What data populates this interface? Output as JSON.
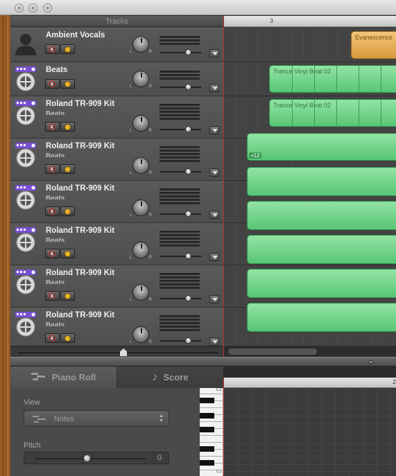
{
  "tracks_header": "Tracks",
  "tracks": [
    {
      "name": "Ambient Vocals",
      "subname": ""
    },
    {
      "name": "Beats",
      "subname": ""
    },
    {
      "name": "Roland TR-909 Kit",
      "subname": "Beats"
    },
    {
      "name": "Roland TR-909 Kit",
      "subname": "Beats"
    },
    {
      "name": "Roland TR-909 Kit",
      "subname": "Beats"
    },
    {
      "name": "Roland TR-909 Kit",
      "subname": "Beats"
    },
    {
      "name": "Roland TR-909 Kit",
      "subname": "Beats"
    },
    {
      "name": "Roland TR-909 Kit",
      "subname": "Beats"
    }
  ],
  "lr_labels": {
    "left": "L",
    "right": "R"
  },
  "ruler": {
    "mark": "3"
  },
  "regions": {
    "vocals": "Evanescence",
    "beat1": "Trance Vinyl Beat 02",
    "beat2": "Trance Vinyl Beat 02",
    "badge": "+12"
  },
  "editor": {
    "tab_piano_roll": "Piano Roll",
    "tab_score": "Score",
    "view_label": "View",
    "view_value": "Notes",
    "pitch_label": "Pitch",
    "pitch_value": "0",
    "roll_ruler_mark": "2",
    "piano_top_note": "C2",
    "piano_bottom_note": "C1"
  }
}
